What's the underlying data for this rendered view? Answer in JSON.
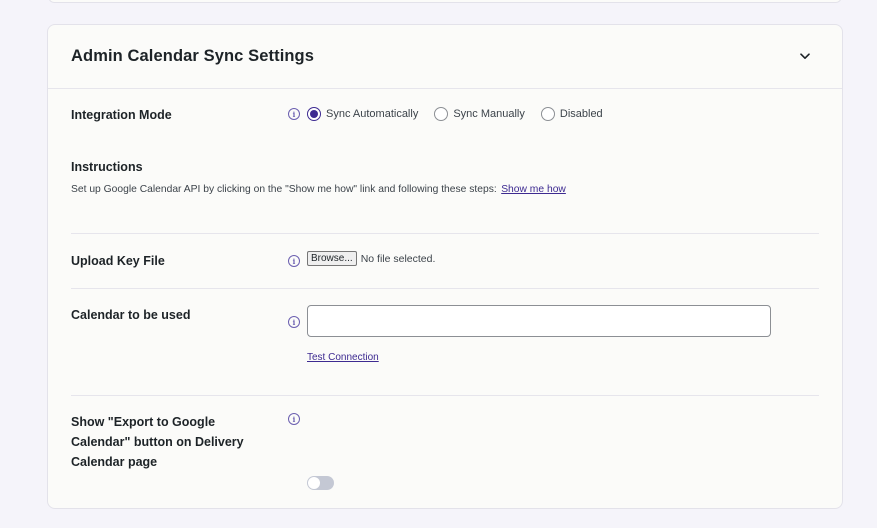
{
  "card": {
    "title": "Admin Calendar Sync Settings"
  },
  "integration_mode": {
    "label": "Integration Mode",
    "options": [
      "Sync Automatically",
      "Sync Manually",
      "Disabled"
    ],
    "selected": "Sync Automatically"
  },
  "instructions": {
    "label": "Instructions",
    "text": "Set up Google Calendar API by clicking on the \"Show me how\" link and following these steps:",
    "link": "Show me how"
  },
  "upload_key": {
    "label": "Upload Key File",
    "browse_label": "Browse...",
    "status": "No file selected."
  },
  "calendar": {
    "label": "Calendar to be used",
    "value": "",
    "test_link": "Test Connection"
  },
  "export_button": {
    "label": "Show \"Export to Google Calendar\" button on Delivery Calendar page",
    "enabled": false
  },
  "colors": {
    "accent": "#3d2a91",
    "background": "#f5f4fa",
    "card": "#fbfbf9"
  }
}
